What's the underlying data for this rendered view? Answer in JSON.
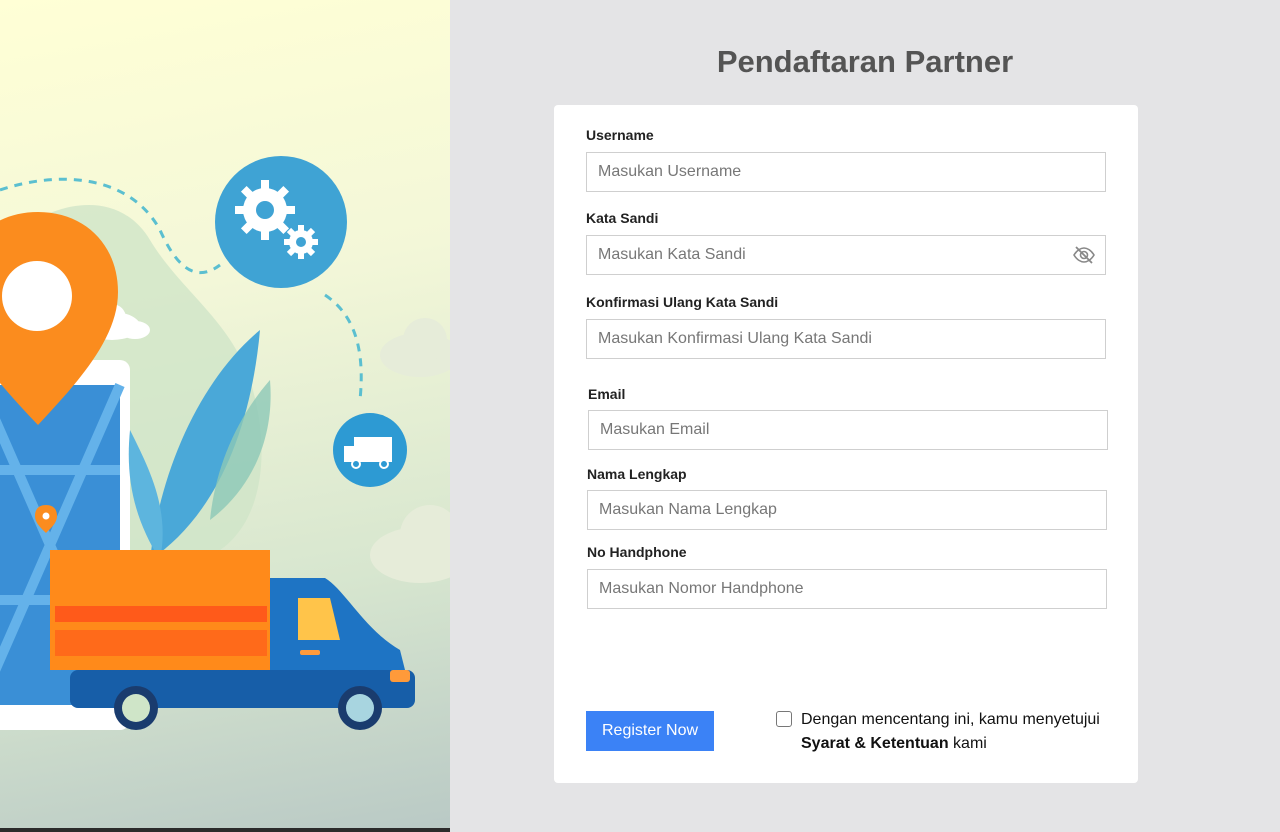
{
  "page": {
    "title": "Pendaftaran Partner"
  },
  "form": {
    "username": {
      "label": "Username",
      "placeholder": "Masukan Username",
      "value": ""
    },
    "password": {
      "label": "Kata Sandi",
      "placeholder": "Masukan Kata Sandi",
      "value": "",
      "toggle_icon": "eye-off-icon"
    },
    "confirm_password": {
      "label": "Konfirmasi Ulang Kata Sandi",
      "placeholder": "Masukan Konfirmasi Ulang Kata Sandi",
      "value": ""
    },
    "email": {
      "label": "Email",
      "placeholder": "Masukan Email",
      "value": ""
    },
    "full_name": {
      "label": "Nama Lengkap",
      "placeholder": "Masukan Nama Lengkap",
      "value": ""
    },
    "phone": {
      "label": "No Handphone",
      "placeholder": "Masukan Nomor Handphone",
      "value": ""
    },
    "register_label": "Register Now",
    "terms": {
      "checked": false,
      "text_before": "Dengan mencentang ini, kamu menyetujui",
      "link_text": "Syarat & Ketentuan",
      "text_after": "kami"
    }
  },
  "colors": {
    "primary_button": "#3b82f6",
    "page_background": "#e4e4e6",
    "title_text": "#545454"
  },
  "illustration": {
    "icons": [
      "map-pin-icon",
      "gears-icon",
      "delivery-truck-icon",
      "cloud-icon",
      "leaf-icon"
    ]
  }
}
